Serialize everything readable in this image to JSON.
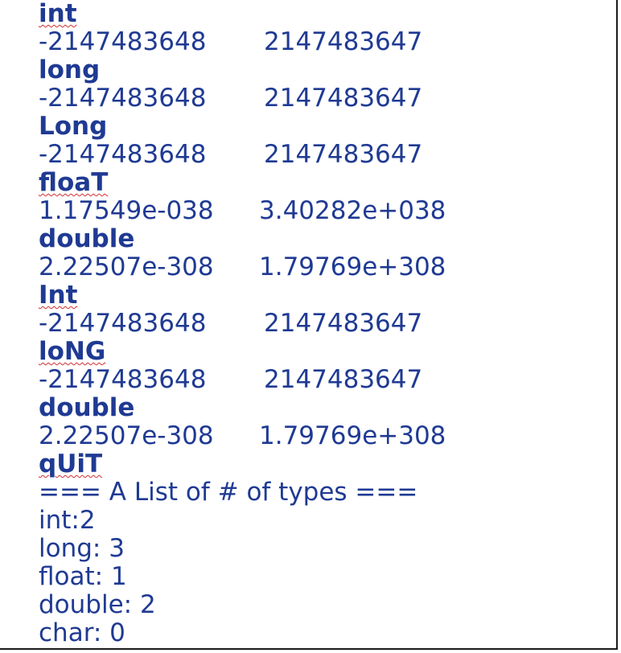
{
  "entries": [
    {
      "type_input": "int",
      "spell": true,
      "min": "-2147483648",
      "max": "2147483647"
    },
    {
      "type_input": "long",
      "spell": false,
      "min": "-2147483648",
      "max": "2147483647"
    },
    {
      "type_input": "Long",
      "spell": false,
      "min": "-2147483648",
      "max": "2147483647"
    },
    {
      "type_input": "floaT",
      "spell": true,
      "min": "1.17549e-038",
      "max": "3.40282e+038"
    },
    {
      "type_input": "double",
      "spell": false,
      "min": "2.22507e-308",
      "max": "1.79769e+308"
    },
    {
      "type_input": "Int",
      "spell": true,
      "min": "-2147483648",
      "max": "2147483647"
    },
    {
      "type_input": "loNG",
      "spell": true,
      "min": "-2147483648",
      "max": "2147483647"
    },
    {
      "type_input": "double",
      "spell": false,
      "min": "2.22507e-308",
      "max": "1.79769e+308"
    }
  ],
  "quit_input": "qUiT",
  "summary": {
    "heading": "=== A List of # of types ===",
    "lines": [
      "int:2",
      "long: 3",
      "float: 1",
      "double: 2",
      "char: 0"
    ]
  },
  "colors": {
    "text": "#1f3a93",
    "spellcheck_underline": "#d32f2f",
    "border": "#1a1a1a"
  }
}
